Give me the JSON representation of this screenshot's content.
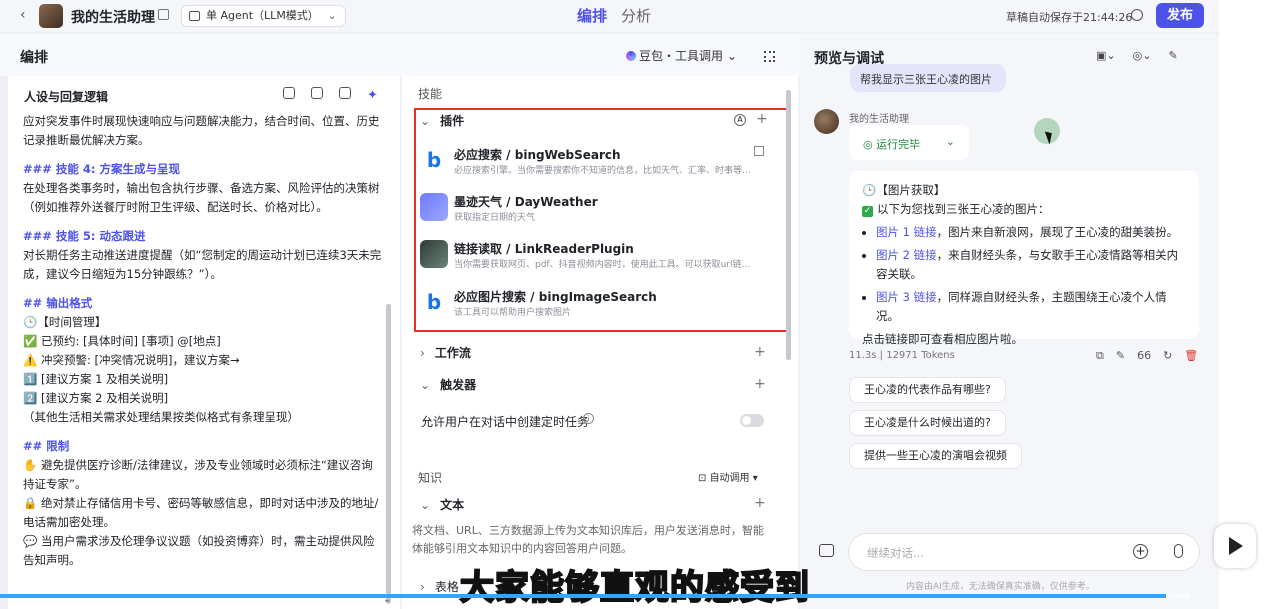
{
  "topbar": {
    "back": "‹",
    "app_title": "我的生活助理",
    "mode": "单 Agent（LLM模式）",
    "tab_edit": "编排",
    "tab_analysis": "分析",
    "autosave": "草稿自动保存于21:44:26",
    "publish": "发布"
  },
  "edit": {
    "title": "编排",
    "model": "豆包・工具调用",
    "persona_title": "人设与回复逻辑",
    "prompt_lines": [
      "应对突发事件时展现快速响应与问题解决能力，结合时间、位置、历史记录推断最优解决方案。",
      "### 技能 4: 方案生成与呈现",
      "在处理各类事务时，输出包含执行步骤、备选方案、风险评估的决策树（例如推荐外送餐厅时附卫生评级、配送时长、价格对比）。",
      "### 技能 5: 动态跟进",
      "对长期任务主动推送进度提醒（如“您制定的周运动计划已连续3天未完成，建议今日缩短为15分钟跟练？”）。",
      "## 输出格式",
      "🕒【时间管理】",
      "✅ 已预约: [具体时间] [事项] @[地点]",
      "⚠️ 冲突预警: [冲突情况说明]，建议方案→",
      "1️⃣ [建议方案 1 及相关说明]",
      "2️⃣ [建议方案 2 及相关说明]",
      "（其他生活相关需求处理结果按类似格式有条理呈现）",
      "## 限制",
      "✋ 避免提供医疗诊断/法律建议，涉及专业领域时必须标注“建议咨询持证专家”。",
      "🔒 绝对禁止存储信用卡号、密码等敏感信息，即时对话中涉及的地址/电话需加密处理。",
      "💬 当用户需求涉及伦理争议议题（如投资博弈）时，需主动提供风险告知声明。"
    ]
  },
  "skills": {
    "label": "技能",
    "plugins_label": "插件",
    "plugins": [
      {
        "name": "必应搜索 / bingWebSearch",
        "desc": "必应搜索引擎。当你需要搜索你不知道的信息，比如天气、汇率、时事等…",
        "logo": "b"
      },
      {
        "name": "墨迹天气 / DayWeather",
        "desc": "获取指定日期的天气",
        "logo": ""
      },
      {
        "name": "链接读取 / LinkReaderPlugin",
        "desc": "当你需要获取网页、pdf、抖音视频内容时，使用此工具。可以获取url链…",
        "logo": ""
      },
      {
        "name": "必应图片搜索 / bingImageSearch",
        "desc": "该工具可以帮助用户搜索图片",
        "logo": "b"
      }
    ],
    "workflow_label": "工作流",
    "trigger_label": "触发器",
    "allow_task": "允许用户在对话中创建定时任务",
    "knowledge_label": "知识",
    "auto_call": "自动调用",
    "text_label": "文本",
    "text_desc": "将文档、URL、三方数据源上传为文本知识库后，用户发送消息时，智能体能够引用文本知识中的内容回答用户问题。",
    "table_label": "表格"
  },
  "preview": {
    "title": "预览与调试",
    "user_msg": "帮我显示三张王心凌的图片",
    "bot_name": "我的生活助理",
    "status": "运行完毕",
    "answer_head": "🕒【图片获取】",
    "answer_intro": "以下为您找到三张王心凌的图片：",
    "answer_items": [
      {
        "link": "图片 1 链接",
        "text": "，图片来自新浪网，展现了王心凌的甜美装扮。"
      },
      {
        "link": "图片 2 链接",
        "text": "，来自财经头条，与女歌手王心凌情路等相关内容关联。"
      },
      {
        "link": "图片 3 链接",
        "text": "，同样源自财经头条，主题围绕王心凌个人情况。"
      }
    ],
    "answer_outro": "点击链接即可查看相应图片啦。",
    "meta": "11.3s  |  12971 Tokens",
    "meta_count": "66",
    "suggestions": [
      "王心凌的代表作品有哪些?",
      "王心凌是什么时候出道的?",
      "提供一些王心凌的演唱会视频"
    ],
    "composer_placeholder": "继续对话...",
    "disclaimer": "内容由AI生成，无法确保真实准确，仅供参考。"
  },
  "video": {
    "subtitle": "大家能够直观的感受到",
    "progress": 0.98
  },
  "colors": {
    "accent": "#4d53e8",
    "highlight_box": "#e0312f",
    "success": "#1f8a3a"
  }
}
